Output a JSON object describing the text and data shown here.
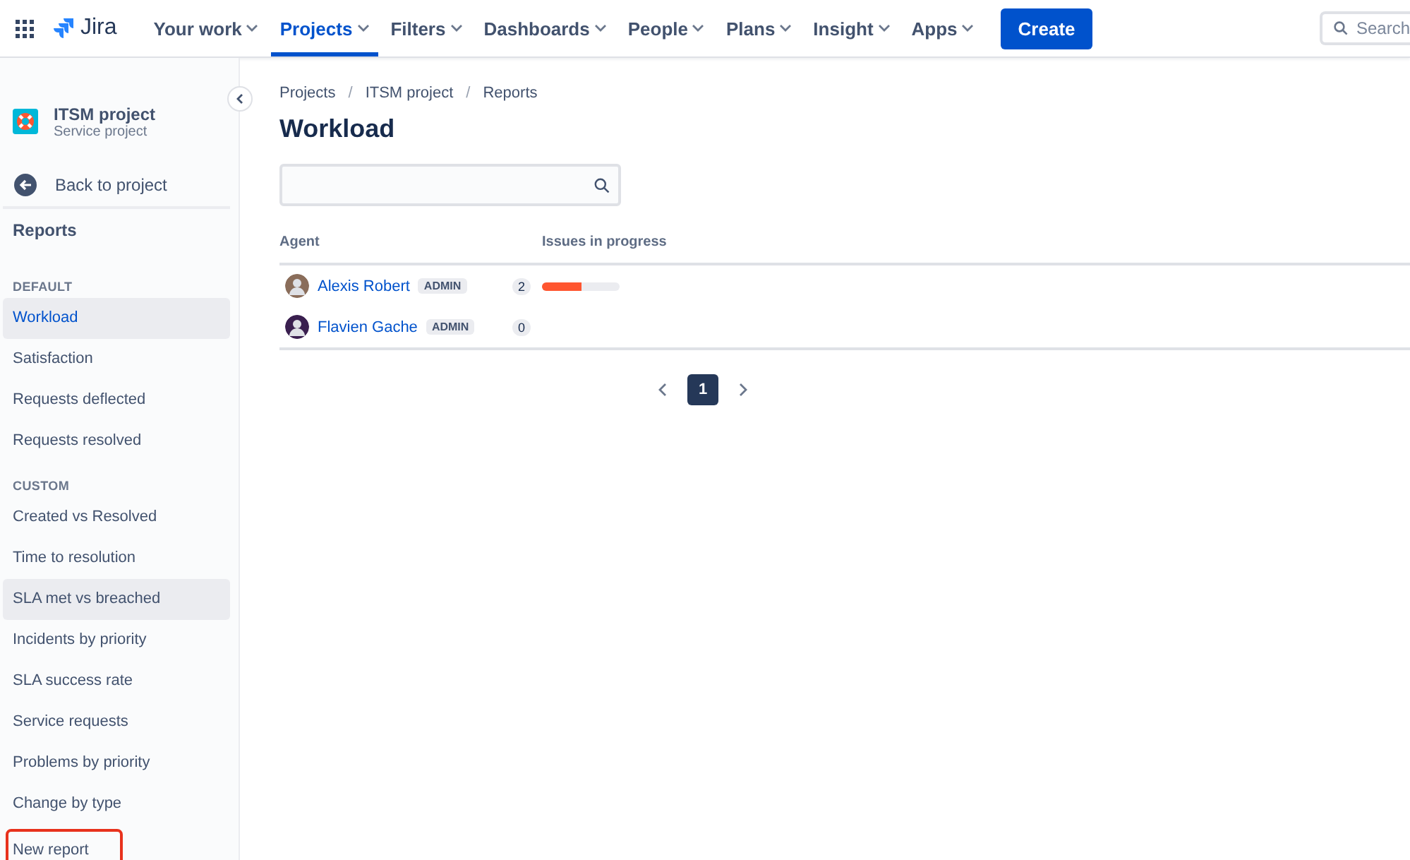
{
  "topnav": {
    "logo": "Jira",
    "items": [
      {
        "label": "Your work",
        "selected": false
      },
      {
        "label": "Projects",
        "selected": true
      },
      {
        "label": "Filters",
        "selected": false
      },
      {
        "label": "Dashboards",
        "selected": false
      },
      {
        "label": "People",
        "selected": false
      },
      {
        "label": "Plans",
        "selected": false
      },
      {
        "label": "Insight",
        "selected": false
      },
      {
        "label": "Apps",
        "selected": false
      }
    ],
    "create_button": "Create",
    "search": {
      "placeholder": "Search"
    }
  },
  "sidebar": {
    "project": {
      "name": "ITSM project",
      "type": "Service project"
    },
    "back": "Back to project",
    "title": "Reports",
    "sections": [
      {
        "heading": "DEFAULT",
        "items": [
          {
            "label": "Workload",
            "selected": true,
            "hovered": false,
            "highlighted": false
          },
          {
            "label": "Satisfaction",
            "selected": false,
            "hovered": false,
            "highlighted": false
          },
          {
            "label": "Requests deflected",
            "selected": false,
            "hovered": false,
            "highlighted": false
          },
          {
            "label": "Requests resolved",
            "selected": false,
            "hovered": false,
            "highlighted": false
          }
        ]
      },
      {
        "heading": "CUSTOM",
        "items": [
          {
            "label": "Created vs Resolved",
            "selected": false,
            "hovered": false,
            "highlighted": false
          },
          {
            "label": "Time to resolution",
            "selected": false,
            "hovered": false,
            "highlighted": false
          },
          {
            "label": "SLA met vs breached",
            "selected": false,
            "hovered": true,
            "highlighted": false
          },
          {
            "label": "Incidents by priority",
            "selected": false,
            "hovered": false,
            "highlighted": false
          },
          {
            "label": "SLA success rate",
            "selected": false,
            "hovered": false,
            "highlighted": false
          },
          {
            "label": "Service requests",
            "selected": false,
            "hovered": false,
            "highlighted": false
          },
          {
            "label": "Problems by priority",
            "selected": false,
            "hovered": false,
            "highlighted": false
          },
          {
            "label": "Change by type",
            "selected": false,
            "hovered": false,
            "highlighted": false
          }
        ]
      }
    ],
    "footer_item": {
      "label": "New report",
      "highlighted": true
    }
  },
  "breadcrumbs": [
    {
      "kind": "link",
      "text": "Projects"
    },
    {
      "kind": "separator",
      "text": "/"
    },
    {
      "kind": "link",
      "text": "ITSM project"
    },
    {
      "kind": "separator",
      "text": "/"
    },
    {
      "kind": "link",
      "text": "Reports"
    }
  ],
  "title": "Workload",
  "table": {
    "columns": [
      "Agent",
      "Issues in progress"
    ],
    "rows": [
      {
        "agent": "Alexis Robert",
        "role": "ADMIN",
        "count": "2",
        "level": 0.5
      },
      {
        "agent": "Flavien Gache",
        "role": "ADMIN",
        "count": "0"
      }
    ]
  },
  "pagination": {
    "pages": [
      {
        "label": "1",
        "selected": true
      }
    ]
  }
}
